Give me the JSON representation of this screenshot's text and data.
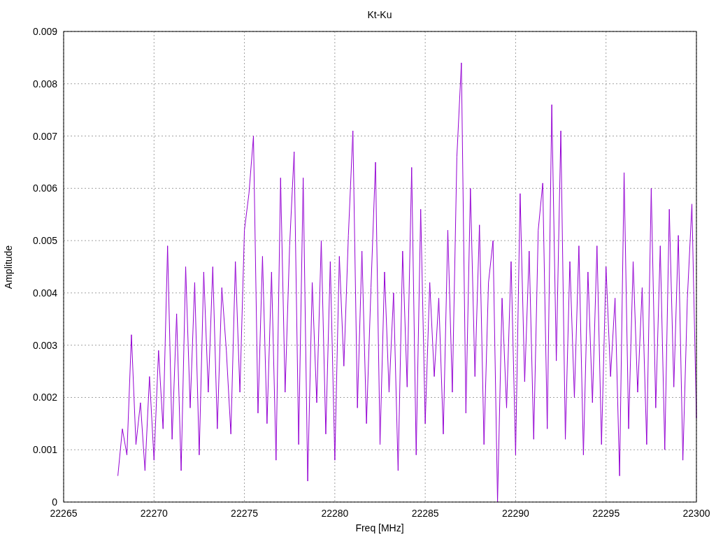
{
  "plot": {
    "chart_data": {
      "type": "line",
      "grid": true,
      "title": "Kt-Ku",
      "xlabel": "Freq [MHz]",
      "ylabel": "Amplitude",
      "xlim": [
        22265,
        22300
      ],
      "ylim": [
        0,
        0.009
      ],
      "xticks": [
        22265,
        22270,
        22275,
        22280,
        22285,
        22290,
        22295,
        22300
      ],
      "yticks": [
        0,
        0.001,
        0.002,
        0.003,
        0.004,
        0.005,
        0.006,
        0.007,
        0.008,
        0.009
      ],
      "x": [
        22268,
        22268.25,
        22268.5,
        22268.75,
        22269,
        22269.25,
        22269.5,
        22269.75,
        22270,
        22270.25,
        22270.5,
        22270.75,
        22271,
        22271.25,
        22271.5,
        22271.75,
        22272,
        22272.25,
        22272.5,
        22272.75,
        22273,
        22273.25,
        22273.5,
        22273.75,
        22274,
        22274.25,
        22274.5,
        22274.75,
        22275,
        22275.25,
        22275.5,
        22275.75,
        22276,
        22276.25,
        22276.5,
        22276.75,
        22277,
        22277.25,
        22277.5,
        22277.75,
        22278,
        22278.25,
        22278.5,
        22278.75,
        22279,
        22279.25,
        22279.5,
        22279.75,
        22280,
        22280.25,
        22280.5,
        22280.75,
        22281,
        22281.25,
        22281.5,
        22281.75,
        22282,
        22282.25,
        22282.5,
        22282.75,
        22283,
        22283.25,
        22283.5,
        22283.75,
        22284,
        22284.25,
        22284.5,
        22284.75,
        22285,
        22285.25,
        22285.5,
        22285.75,
        22286,
        22286.25,
        22286.5,
        22286.75,
        22287,
        22287.25,
        22287.5,
        22287.75,
        22288,
        22288.25,
        22288.5,
        22288.75,
        22289,
        22289.25,
        22289.5,
        22289.75,
        22290,
        22290.25,
        22290.5,
        22290.75,
        22291,
        22291.25,
        22291.5,
        22291.75,
        22292,
        22292.25,
        22292.5,
        22292.75,
        22293,
        22293.25,
        22293.5,
        22293.75,
        22294,
        22294.25,
        22294.5,
        22294.75,
        22295,
        22295.25,
        22295.5,
        22295.75,
        22296,
        22296.25,
        22296.5,
        22296.75,
        22297,
        22297.25,
        22297.5,
        22297.75,
        22298,
        22298.25,
        22298.5,
        22298.75,
        22299,
        22299.25,
        22299.5,
        22299.75,
        22300
      ],
      "series": [
        {
          "color": "#9400d3",
          "values": [
            0.0005,
            0.0014,
            0.0009,
            0.0032,
            0.0011,
            0.0019,
            0.0006,
            0.0024,
            0.0008,
            0.0029,
            0.0014,
            0.0049,
            0.0012,
            0.0036,
            0.0006,
            0.0045,
            0.0018,
            0.0042,
            0.0009,
            0.0044,
            0.0021,
            0.0045,
            0.0014,
            0.0041,
            0.0029,
            0.0013,
            0.0046,
            0.0021,
            0.0052,
            0.0059,
            0.007,
            0.0017,
            0.0047,
            0.0015,
            0.0044,
            0.0008,
            0.0062,
            0.0021,
            0.0049,
            0.0067,
            0.0011,
            0.0062,
            0.0004,
            0.0042,
            0.0019,
            0.005,
            0.0013,
            0.0046,
            0.0008,
            0.0047,
            0.0026,
            0.0051,
            0.0071,
            0.0018,
            0.0048,
            0.0015,
            0.0041,
            0.0065,
            0.0011,
            0.0044,
            0.0021,
            0.004,
            0.0006,
            0.0048,
            0.0022,
            0.0064,
            0.0009,
            0.0056,
            0.0015,
            0.0042,
            0.0024,
            0.0039,
            0.0013,
            0.0052,
            0.0021,
            0.0066,
            0.0084,
            0.0017,
            0.006,
            0.0024,
            0.0053,
            0.0011,
            0.0042,
            0.005,
            0,
            0.0039,
            0.0018,
            0.0046,
            0.0009,
            0.0059,
            0.0023,
            0.0048,
            0.0012,
            0.0052,
            0.0061,
            0.0014,
            0.0076,
            0.0027,
            0.0071,
            0.0012,
            0.0046,
            0.002,
            0.0049,
            0.0009,
            0.0044,
            0.0019,
            0.0049,
            0.0011,
            0.0045,
            0.0024,
            0.0039,
            0.0005,
            0.0063,
            0.0014,
            0.0046,
            0.0021,
            0.0041,
            0.0011,
            0.006,
            0.0018,
            0.0049,
            0.001,
            0.0056,
            0.0022,
            0.0051,
            0.0008,
            0.0039,
            0.0057,
            0.0016
          ]
        }
      ]
    }
  }
}
